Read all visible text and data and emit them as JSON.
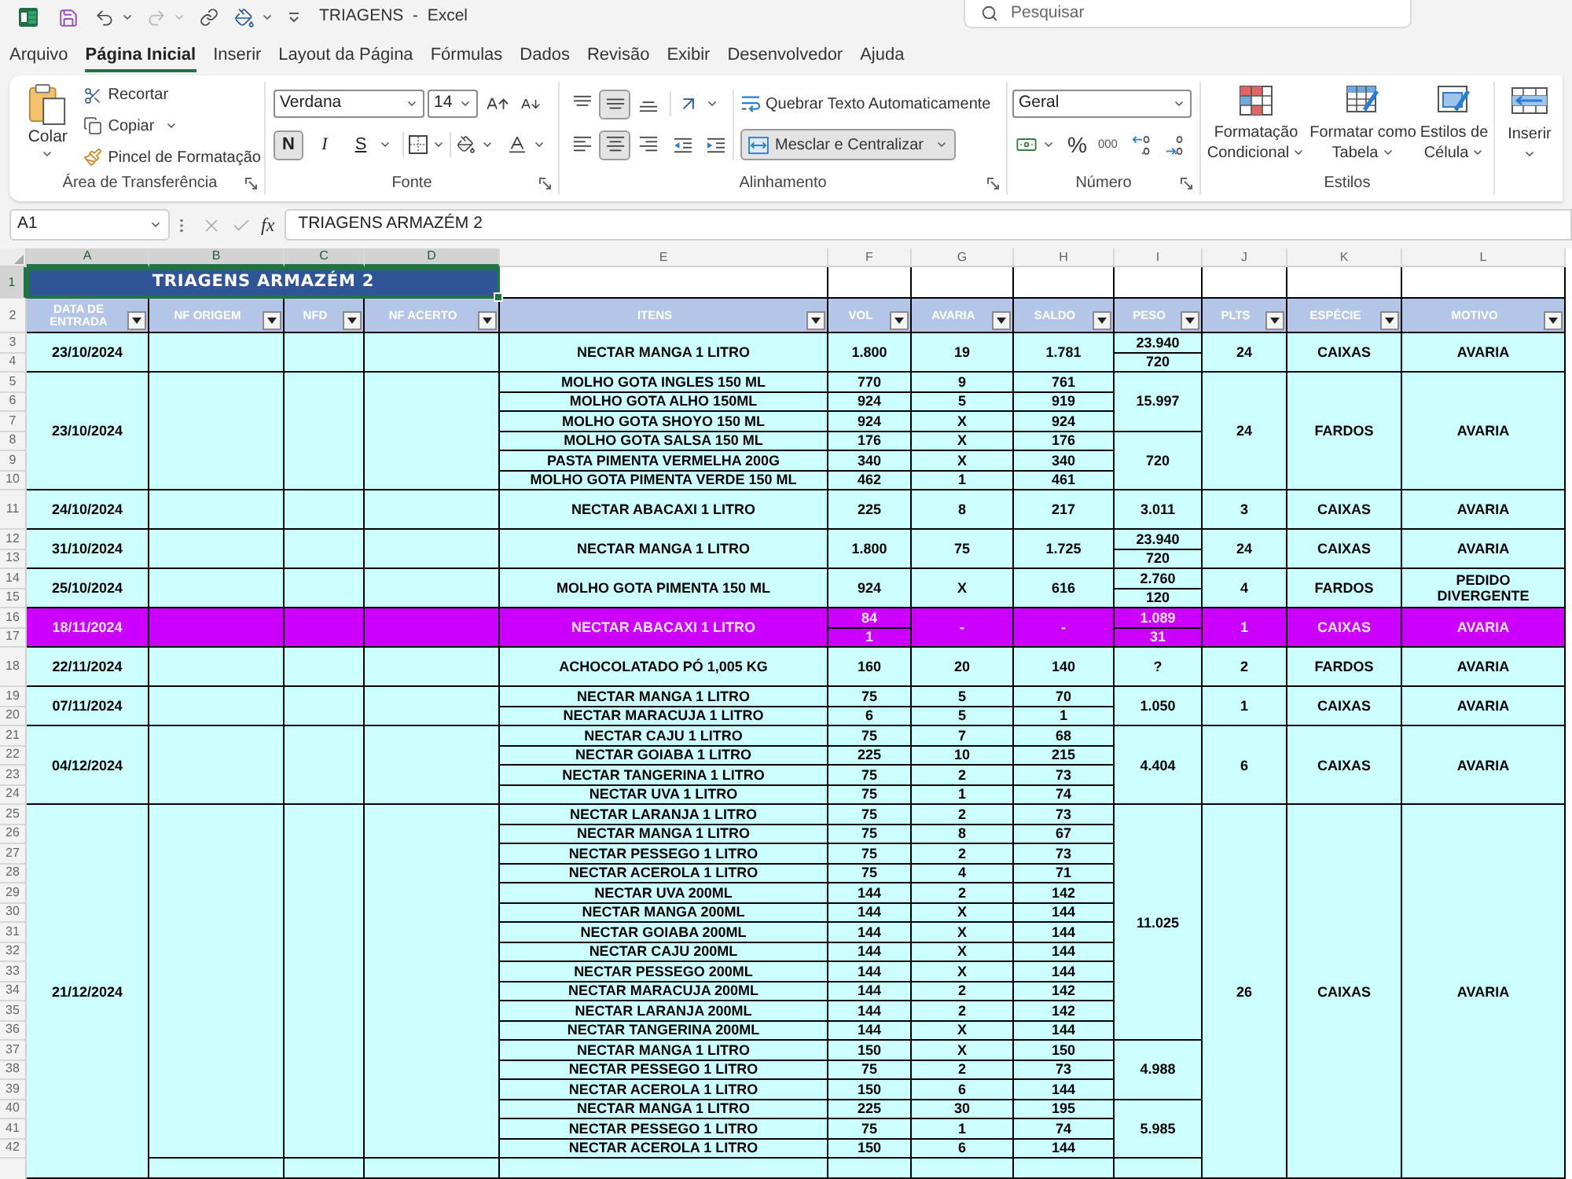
{
  "title_bar": {
    "title": "TRIAGENS  -  Excel",
    "search_placeholder": "Pesquisar"
  },
  "tabs": [
    {
      "label": "Arquivo",
      "selected": false
    },
    {
      "label": "Página Inicial",
      "selected": true
    },
    {
      "label": "Inserir",
      "selected": false
    },
    {
      "label": "Layout da Página",
      "selected": false
    },
    {
      "label": "Fórmulas",
      "selected": false
    },
    {
      "label": "Dados",
      "selected": false
    },
    {
      "label": "Revisão",
      "selected": false
    },
    {
      "label": "Exibir",
      "selected": false
    },
    {
      "label": "Desenvolvedor",
      "selected": false
    },
    {
      "label": "Ajuda",
      "selected": false
    }
  ],
  "ribbon": {
    "clipboard": {
      "paste": "Colar",
      "cut": "Recortar",
      "copy": "Copiar",
      "format_painter": "Pincel de Formatação",
      "label": "Área de Transferência"
    },
    "font": {
      "name": "Verdana",
      "size": "14",
      "styles": [
        {
          "kind": "bold",
          "label": "N",
          "on": true
        },
        {
          "kind": "italic",
          "label": "I",
          "on": false
        },
        {
          "kind": "underline",
          "label": "S",
          "on": false
        }
      ],
      "label": "Fonte"
    },
    "alignment": {
      "vertical": [
        {
          "kind": "top",
          "on": false
        },
        {
          "kind": "middle",
          "on": true
        },
        {
          "kind": "bottom",
          "on": false
        }
      ],
      "horizontal": [
        {
          "kind": "left",
          "on": false
        },
        {
          "kind": "center",
          "on": true
        },
        {
          "kind": "right",
          "on": false
        }
      ],
      "wrap_text": "Quebrar Texto Automaticamente",
      "merge": {
        "label": "Mesclar e Centralizar",
        "on": true
      },
      "label": "Alinhamento"
    },
    "number": {
      "format": "Geral",
      "percent": "%",
      "thousands": "000",
      "label": "Número"
    },
    "styles": {
      "buttons": [
        {
          "kind": "conditional",
          "label": "Formatação Condicional"
        },
        {
          "kind": "table",
          "label": "Formatar como Tabela"
        },
        {
          "kind": "cell",
          "label": "Estilos de Célula"
        }
      ],
      "label": "Estilos"
    },
    "cells": {
      "insert": "Inserir"
    }
  },
  "formula_bar": {
    "name_box": "A1",
    "function_label": "fx",
    "formula": "TRIAGENS ARMAZÉM 2"
  },
  "sheet": {
    "columns": [
      {
        "label": "A",
        "selected": true
      },
      {
        "label": "B",
        "selected": true
      },
      {
        "label": "C",
        "selected": true
      },
      {
        "label": "D",
        "selected": true
      },
      {
        "label": "E",
        "selected": false
      },
      {
        "label": "F",
        "selected": false
      },
      {
        "label": "G",
        "selected": false
      },
      {
        "label": "H",
        "selected": false
      },
      {
        "label": "I",
        "selected": false
      },
      {
        "label": "J",
        "selected": false
      },
      {
        "label": "K",
        "selected": false
      },
      {
        "label": "L",
        "selected": false
      }
    ],
    "title_row": {
      "number": "1",
      "selected": true,
      "title": "TRIAGENS ARMAZÉM 2"
    },
    "header_row": {
      "number": "2",
      "headers": [
        "DATA DE ENTRADA",
        "NF ORIGEM",
        "NFD",
        "NF ACERTO",
        "ITENS",
        "VOL",
        "AVARIA",
        "SALDO",
        "PESO",
        "PLTS",
        "ESPÉCIE",
        "MOTIVO"
      ]
    },
    "entries": [
      {
        "date": "23/10/2024",
        "highlighted": false,
        "plts": "24",
        "especie": "CAIXAS",
        "motivo": "AVARIA",
        "groups": [
          {
            "peso": [
              "23.940",
              "720"
            ],
            "items": [
              {
                "rows": [
                  "3",
                  "4"
                ],
                "name": "NECTAR MANGA 1 LITRO",
                "vol": [
                  "1.800"
                ],
                "avaria": "19",
                "saldo": "1.781"
              }
            ]
          }
        ]
      },
      {
        "date": "23/10/2024",
        "highlighted": false,
        "plts": "24",
        "especie": "FARDOS",
        "motivo": "AVARIA",
        "groups": [
          {
            "peso": [
              "15.997"
            ],
            "items": [
              {
                "rows": [
                  "5"
                ],
                "name": "MOLHO GOTA INGLES 150 ML",
                "vol": [
                  "770"
                ],
                "avaria": "9",
                "saldo": "761"
              },
              {
                "rows": [
                  "6"
                ],
                "name": "MOLHO GOTA ALHO 150ML",
                "vol": [
                  "924"
                ],
                "avaria": "5",
                "saldo": "919"
              },
              {
                "rows": [
                  "7"
                ],
                "name": "MOLHO GOTA SHOYO 150 ML",
                "vol": [
                  "924"
                ],
                "avaria": "X",
                "saldo": "924"
              }
            ]
          },
          {
            "peso": [
              "720"
            ],
            "items": [
              {
                "rows": [
                  "8"
                ],
                "name": "MOLHO GOTA SALSA 150 ML",
                "vol": [
                  "176"
                ],
                "avaria": "X",
                "saldo": "176"
              },
              {
                "rows": [
                  "9"
                ],
                "name": "PASTA PIMENTA VERMELHA 200G",
                "vol": [
                  "340"
                ],
                "avaria": "X",
                "saldo": "340"
              },
              {
                "rows": [
                  "10"
                ],
                "name": "MOLHO GOTA PIMENTA VERDE 150 ML",
                "vol": [
                  "462"
                ],
                "avaria": "1",
                "saldo": "461"
              }
            ]
          }
        ]
      },
      {
        "date": "24/10/2024",
        "highlighted": false,
        "plts": "3",
        "especie": "CAIXAS",
        "motivo": "AVARIA",
        "groups": [
          {
            "peso": [
              "3.011"
            ],
            "items": [
              {
                "rows": [
                  "11"
                ],
                "name": "NECTAR ABACAXI 1 LITRO",
                "vol": [
                  "225"
                ],
                "avaria": "8",
                "saldo": "217"
              }
            ]
          }
        ]
      },
      {
        "date": "31/10/2024",
        "highlighted": false,
        "plts": "24",
        "especie": "CAIXAS",
        "motivo": "AVARIA",
        "groups": [
          {
            "peso": [
              "23.940",
              "720"
            ],
            "items": [
              {
                "rows": [
                  "12",
                  "13"
                ],
                "name": "NECTAR MANGA 1 LITRO",
                "vol": [
                  "1.800"
                ],
                "avaria": "75",
                "saldo": "1.725"
              }
            ]
          }
        ]
      },
      {
        "date": "25/10/2024",
        "highlighted": false,
        "plts": "4",
        "especie": "FARDOS",
        "motivo": "PEDIDO DIVERGENTE",
        "groups": [
          {
            "peso": [
              "2.760",
              "120"
            ],
            "items": [
              {
                "rows": [
                  "14",
                  "15"
                ],
                "name": "MOLHO GOTA PIMENTA 150 ML",
                "vol": [
                  "924"
                ],
                "avaria": "X",
                "saldo": "616"
              }
            ]
          }
        ]
      },
      {
        "date": "18/11/2024",
        "highlighted": true,
        "plts": "1",
        "especie": "CAIXAS",
        "motivo": "AVARIA",
        "groups": [
          {
            "peso": [
              "1.089",
              "31"
            ],
            "items": [
              {
                "rows": [
                  "16",
                  "17"
                ],
                "name": "NECTAR ABACAXI 1 LITRO",
                "vol": [
                  "84",
                  "1"
                ],
                "avaria": "-",
                "saldo": "-"
              }
            ]
          }
        ]
      },
      {
        "date": "22/11/2024",
        "highlighted": false,
        "plts": "2",
        "especie": "FARDOS",
        "motivo": "AVARIA",
        "groups": [
          {
            "peso": [
              "?"
            ],
            "items": [
              {
                "rows": [
                  "18"
                ],
                "name": "ACHOCOLATADO PÓ 1,005 KG",
                "vol": [
                  "160"
                ],
                "avaria": "20",
                "saldo": "140"
              }
            ]
          }
        ]
      },
      {
        "date": "07/11/2024",
        "highlighted": false,
        "plts": "1",
        "especie": "CAIXAS",
        "motivo": "AVARIA",
        "groups": [
          {
            "peso": [
              "1.050"
            ],
            "items": [
              {
                "rows": [
                  "19"
                ],
                "name": "NECTAR MANGA 1 LITRO",
                "vol": [
                  "75"
                ],
                "avaria": "5",
                "saldo": "70"
              },
              {
                "rows": [
                  "20"
                ],
                "name": "NECTAR MARACUJA 1 LITRO",
                "vol": [
                  "6"
                ],
                "avaria": "5",
                "saldo": "1"
              }
            ]
          }
        ]
      },
      {
        "date": "04/12/2024",
        "highlighted": false,
        "plts": "6",
        "especie": "CAIXAS",
        "motivo": "AVARIA",
        "groups": [
          {
            "peso": [
              "4.404"
            ],
            "items": [
              {
                "rows": [
                  "21"
                ],
                "name": "NECTAR CAJU 1 LITRO",
                "vol": [
                  "75"
                ],
                "avaria": "7",
                "saldo": "68"
              },
              {
                "rows": [
                  "22"
                ],
                "name": "NECTAR GOIABA 1 LITRO",
                "vol": [
                  "225"
                ],
                "avaria": "10",
                "saldo": "215"
              },
              {
                "rows": [
                  "23"
                ],
                "name": "NECTAR TANGERINA 1 LITRO",
                "vol": [
                  "75"
                ],
                "avaria": "2",
                "saldo": "73"
              },
              {
                "rows": [
                  "24"
                ],
                "name": "NECTAR UVA 1 LITRO",
                "vol": [
                  "75"
                ],
                "avaria": "1",
                "saldo": "74"
              }
            ]
          }
        ]
      },
      {
        "date": "21/12/2024",
        "highlighted": false,
        "plts": "26",
        "especie": "CAIXAS",
        "motivo": "AVARIA",
        "groups": [
          {
            "peso": [
              "11.025"
            ],
            "items": [
              {
                "rows": [
                  "25"
                ],
                "name": "NECTAR LARANJA 1 LITRO",
                "vol": [
                  "75"
                ],
                "avaria": "2",
                "saldo": "73"
              },
              {
                "rows": [
                  "26"
                ],
                "name": "NECTAR MANGA 1 LITRO",
                "vol": [
                  "75"
                ],
                "avaria": "8",
                "saldo": "67"
              },
              {
                "rows": [
                  "27"
                ],
                "name": "NECTAR PESSEGO 1 LITRO",
                "vol": [
                  "75"
                ],
                "avaria": "2",
                "saldo": "73"
              },
              {
                "rows": [
                  "28"
                ],
                "name": "NECTAR ACEROLA 1 LITRO",
                "vol": [
                  "75"
                ],
                "avaria": "4",
                "saldo": "71"
              },
              {
                "rows": [
                  "29"
                ],
                "name": "NECTAR UVA 200ML",
                "vol": [
                  "144"
                ],
                "avaria": "2",
                "saldo": "142"
              },
              {
                "rows": [
                  "30"
                ],
                "name": "NECTAR MANGA 200ML",
                "vol": [
                  "144"
                ],
                "avaria": "X",
                "saldo": "144"
              },
              {
                "rows": [
                  "31"
                ],
                "name": "NECTAR GOIABA 200ML",
                "vol": [
                  "144"
                ],
                "avaria": "X",
                "saldo": "144"
              },
              {
                "rows": [
                  "32"
                ],
                "name": "NECTAR CAJU 200ML",
                "vol": [
                  "144"
                ],
                "avaria": "X",
                "saldo": "144"
              },
              {
                "rows": [
                  "33"
                ],
                "name": "NECTAR PESSEGO 200ML",
                "vol": [
                  "144"
                ],
                "avaria": "X",
                "saldo": "144"
              },
              {
                "rows": [
                  "34"
                ],
                "name": "NECTAR MARACUJA 200ML",
                "vol": [
                  "144"
                ],
                "avaria": "2",
                "saldo": "142"
              },
              {
                "rows": [
                  "35"
                ],
                "name": "NECTAR LARANJA 200ML",
                "vol": [
                  "144"
                ],
                "avaria": "2",
                "saldo": "142"
              },
              {
                "rows": [
                  "36"
                ],
                "name": "NECTAR TANGERINA 200ML",
                "vol": [
                  "144"
                ],
                "avaria": "X",
                "saldo": "144"
              }
            ]
          },
          {
            "peso": [
              "4.988"
            ],
            "items": [
              {
                "rows": [
                  "37"
                ],
                "name": "NECTAR MANGA 1 LITRO",
                "vol": [
                  "150"
                ],
                "avaria": "X",
                "saldo": "150"
              },
              {
                "rows": [
                  "38"
                ],
                "name": "NECTAR PESSEGO 1 LITRO",
                "vol": [
                  "75"
                ],
                "avaria": "2",
                "saldo": "73"
              },
              {
                "rows": [
                  "39"
                ],
                "name": "NECTAR ACEROLA 1 LITRO",
                "vol": [
                  "150"
                ],
                "avaria": "6",
                "saldo": "144"
              }
            ]
          },
          {
            "peso": [
              "5.985"
            ],
            "items": [
              {
                "rows": [
                  "40"
                ],
                "name": "NECTAR MANGA 1 LITRO",
                "vol": [
                  "225"
                ],
                "avaria": "30",
                "saldo": "195"
              },
              {
                "rows": [
                  "41"
                ],
                "name": "NECTAR PESSEGO 1 LITRO",
                "vol": [
                  "75"
                ],
                "avaria": "1",
                "saldo": "74"
              },
              {
                "rows": [
                  "42"
                ],
                "name": "NECTAR ACEROLA 1 LITRO",
                "vol": [
                  "150"
                ],
                "avaria": "6",
                "saldo": "144"
              }
            ]
          }
        ]
      }
    ]
  }
}
